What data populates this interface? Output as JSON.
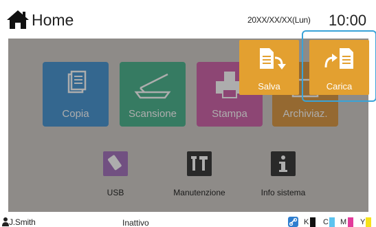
{
  "header": {
    "title": "Home",
    "date": "20XX/XX/XX(Lun)",
    "time": "10:00",
    "home_icon": "home-icon"
  },
  "apps": [
    {
      "label": "Copia",
      "icon": "copy-icon",
      "color": "#3d8fcf"
    },
    {
      "label": "Scansione",
      "icon": "scanner-icon",
      "color": "#3fae87"
    },
    {
      "label": "Stampa",
      "icon": "print-icon",
      "color": "#cc5aa4"
    },
    {
      "label": "Archiviaz.",
      "icon": "storage-icon",
      "color": "#d89137"
    }
  ],
  "small_apps": [
    {
      "label": "USB",
      "icon": "usb-icon",
      "color": "#9e69b9"
    },
    {
      "label": "Manutenzione",
      "icon": "maintenance-icon",
      "color": "#2b2b2b"
    },
    {
      "label": "Info sistema",
      "icon": "info-icon",
      "color": "#2b2b2b"
    }
  ],
  "actions": {
    "save_label": "Salva",
    "load_label": "Carica",
    "accent_color": "#e3a030",
    "highlight_color": "#39a3d8"
  },
  "status_bar": {
    "user": "J.Smith",
    "status": "Inattivo",
    "inks": [
      {
        "label": "K",
        "color": "#111111"
      },
      {
        "label": "C",
        "color": "#5cc3ef"
      },
      {
        "label": "M",
        "color": "#e23b9b"
      },
      {
        "label": "Y",
        "color": "#f6e21a"
      }
    ]
  }
}
